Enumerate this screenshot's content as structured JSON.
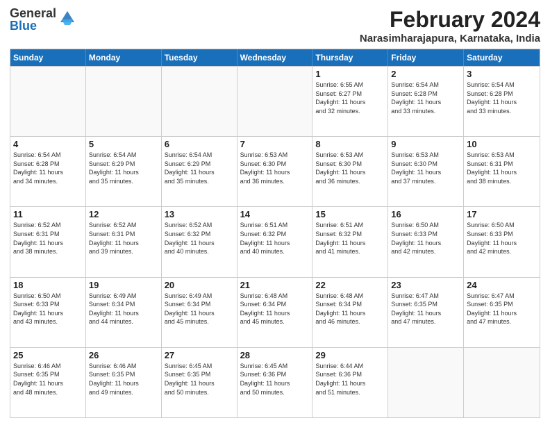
{
  "logo": {
    "general": "General",
    "blue": "Blue"
  },
  "title": "February 2024",
  "subtitle": "Narasimharajapura, Karnataka, India",
  "headers": [
    "Sunday",
    "Monday",
    "Tuesday",
    "Wednesday",
    "Thursday",
    "Friday",
    "Saturday"
  ],
  "rows": [
    [
      {
        "date": "",
        "info": "",
        "empty": true
      },
      {
        "date": "",
        "info": "",
        "empty": true
      },
      {
        "date": "",
        "info": "",
        "empty": true
      },
      {
        "date": "",
        "info": "",
        "empty": true
      },
      {
        "date": "1",
        "info": "Sunrise: 6:55 AM\nSunset: 6:27 PM\nDaylight: 11 hours\nand 32 minutes.",
        "empty": false
      },
      {
        "date": "2",
        "info": "Sunrise: 6:54 AM\nSunset: 6:28 PM\nDaylight: 11 hours\nand 33 minutes.",
        "empty": false
      },
      {
        "date": "3",
        "info": "Sunrise: 6:54 AM\nSunset: 6:28 PM\nDaylight: 11 hours\nand 33 minutes.",
        "empty": false
      }
    ],
    [
      {
        "date": "4",
        "info": "Sunrise: 6:54 AM\nSunset: 6:28 PM\nDaylight: 11 hours\nand 34 minutes.",
        "empty": false
      },
      {
        "date": "5",
        "info": "Sunrise: 6:54 AM\nSunset: 6:29 PM\nDaylight: 11 hours\nand 35 minutes.",
        "empty": false
      },
      {
        "date": "6",
        "info": "Sunrise: 6:54 AM\nSunset: 6:29 PM\nDaylight: 11 hours\nand 35 minutes.",
        "empty": false
      },
      {
        "date": "7",
        "info": "Sunrise: 6:53 AM\nSunset: 6:30 PM\nDaylight: 11 hours\nand 36 minutes.",
        "empty": false
      },
      {
        "date": "8",
        "info": "Sunrise: 6:53 AM\nSunset: 6:30 PM\nDaylight: 11 hours\nand 36 minutes.",
        "empty": false
      },
      {
        "date": "9",
        "info": "Sunrise: 6:53 AM\nSunset: 6:30 PM\nDaylight: 11 hours\nand 37 minutes.",
        "empty": false
      },
      {
        "date": "10",
        "info": "Sunrise: 6:53 AM\nSunset: 6:31 PM\nDaylight: 11 hours\nand 38 minutes.",
        "empty": false
      }
    ],
    [
      {
        "date": "11",
        "info": "Sunrise: 6:52 AM\nSunset: 6:31 PM\nDaylight: 11 hours\nand 38 minutes.",
        "empty": false
      },
      {
        "date": "12",
        "info": "Sunrise: 6:52 AM\nSunset: 6:31 PM\nDaylight: 11 hours\nand 39 minutes.",
        "empty": false
      },
      {
        "date": "13",
        "info": "Sunrise: 6:52 AM\nSunset: 6:32 PM\nDaylight: 11 hours\nand 40 minutes.",
        "empty": false
      },
      {
        "date": "14",
        "info": "Sunrise: 6:51 AM\nSunset: 6:32 PM\nDaylight: 11 hours\nand 40 minutes.",
        "empty": false
      },
      {
        "date": "15",
        "info": "Sunrise: 6:51 AM\nSunset: 6:32 PM\nDaylight: 11 hours\nand 41 minutes.",
        "empty": false
      },
      {
        "date": "16",
        "info": "Sunrise: 6:50 AM\nSunset: 6:33 PM\nDaylight: 11 hours\nand 42 minutes.",
        "empty": false
      },
      {
        "date": "17",
        "info": "Sunrise: 6:50 AM\nSunset: 6:33 PM\nDaylight: 11 hours\nand 42 minutes.",
        "empty": false
      }
    ],
    [
      {
        "date": "18",
        "info": "Sunrise: 6:50 AM\nSunset: 6:33 PM\nDaylight: 11 hours\nand 43 minutes.",
        "empty": false
      },
      {
        "date": "19",
        "info": "Sunrise: 6:49 AM\nSunset: 6:34 PM\nDaylight: 11 hours\nand 44 minutes.",
        "empty": false
      },
      {
        "date": "20",
        "info": "Sunrise: 6:49 AM\nSunset: 6:34 PM\nDaylight: 11 hours\nand 45 minutes.",
        "empty": false
      },
      {
        "date": "21",
        "info": "Sunrise: 6:48 AM\nSunset: 6:34 PM\nDaylight: 11 hours\nand 45 minutes.",
        "empty": false
      },
      {
        "date": "22",
        "info": "Sunrise: 6:48 AM\nSunset: 6:34 PM\nDaylight: 11 hours\nand 46 minutes.",
        "empty": false
      },
      {
        "date": "23",
        "info": "Sunrise: 6:47 AM\nSunset: 6:35 PM\nDaylight: 11 hours\nand 47 minutes.",
        "empty": false
      },
      {
        "date": "24",
        "info": "Sunrise: 6:47 AM\nSunset: 6:35 PM\nDaylight: 11 hours\nand 47 minutes.",
        "empty": false
      }
    ],
    [
      {
        "date": "25",
        "info": "Sunrise: 6:46 AM\nSunset: 6:35 PM\nDaylight: 11 hours\nand 48 minutes.",
        "empty": false
      },
      {
        "date": "26",
        "info": "Sunrise: 6:46 AM\nSunset: 6:35 PM\nDaylight: 11 hours\nand 49 minutes.",
        "empty": false
      },
      {
        "date": "27",
        "info": "Sunrise: 6:45 AM\nSunset: 6:35 PM\nDaylight: 11 hours\nand 50 minutes.",
        "empty": false
      },
      {
        "date": "28",
        "info": "Sunrise: 6:45 AM\nSunset: 6:36 PM\nDaylight: 11 hours\nand 50 minutes.",
        "empty": false
      },
      {
        "date": "29",
        "info": "Sunrise: 6:44 AM\nSunset: 6:36 PM\nDaylight: 11 hours\nand 51 minutes.",
        "empty": false
      },
      {
        "date": "",
        "info": "",
        "empty": true
      },
      {
        "date": "",
        "info": "",
        "empty": true
      }
    ]
  ]
}
